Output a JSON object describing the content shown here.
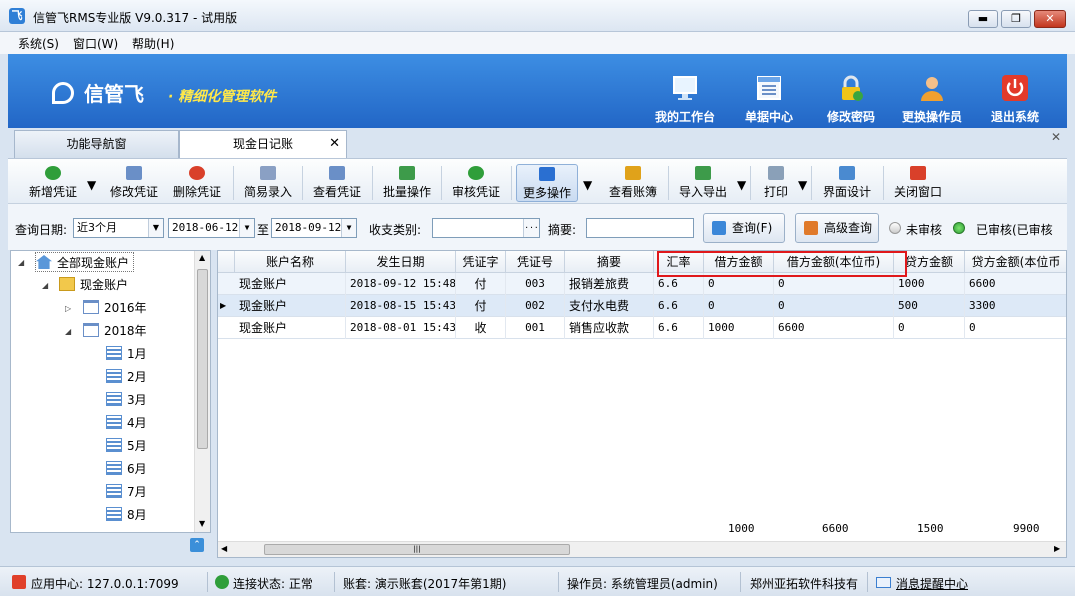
{
  "window": {
    "title": "信管飞RMS专业版 V9.0.317 - 试用版",
    "logo_glyph": "飞",
    "controls": {
      "minimize": "▬",
      "maximize": "❐",
      "close": "✕"
    }
  },
  "menubar": {
    "items": [
      "系统(S)",
      "窗口(W)",
      "帮助(H)"
    ]
  },
  "banner": {
    "brand_name": "信管飞",
    "slogan": "· 精细化管理软件",
    "buttons": [
      {
        "label": "我的工作台",
        "icon": "monitor-icon"
      },
      {
        "label": "单据中心",
        "icon": "document-list-icon"
      },
      {
        "label": "修改密码",
        "icon": "lock-icon"
      },
      {
        "label": "更换操作员",
        "icon": "user-icon"
      },
      {
        "label": "退出系统",
        "icon": "power-icon"
      }
    ]
  },
  "tabs": [
    {
      "label": "功能导航窗",
      "active": false
    },
    {
      "label": "现金日记账",
      "active": true,
      "close": "✕"
    }
  ],
  "panel_close": "✕",
  "toolbar": {
    "buttons": [
      {
        "label": "新增凭证",
        "icon": "add-icon",
        "dropdown": true,
        "color": "#2f9e3a"
      },
      {
        "label": "修改凭证",
        "icon": "edit-icon",
        "color": "#6a8fc7"
      },
      {
        "label": "删除凭证",
        "icon": "delete-icon",
        "color": "#d9402a"
      },
      {
        "label": "简易录入",
        "icon": "grid-icon",
        "color": "#8aa0c4"
      },
      {
        "label": "查看凭证",
        "icon": "view-icon",
        "color": "#6a8fc7"
      },
      {
        "label": "批量操作",
        "icon": "batch-icon",
        "color": "#3d9b4a"
      },
      {
        "label": "审核凭证",
        "icon": "approve-icon",
        "color": "#2f9e3a"
      },
      {
        "label": "更多操作",
        "icon": "double-chevron-down-icon",
        "dropdown": true,
        "color": "#2a6fd1"
      },
      {
        "label": "查看账簿",
        "icon": "ledger-icon",
        "color": "#e0a21a"
      },
      {
        "label": "导入导出",
        "icon": "import-export-icon",
        "dropdown": true,
        "color": "#3d9b4a"
      },
      {
        "label": "打印",
        "icon": "printer-icon",
        "dropdown": true,
        "color": "#8aa0b8"
      },
      {
        "label": "界面设计",
        "icon": "design-icon",
        "color": "#4a8ad0"
      },
      {
        "label": "关闭窗口",
        "icon": "close-window-icon",
        "color": "#d9402a"
      }
    ],
    "dropdown_glyph": "▼"
  },
  "query": {
    "date_label": "查询日期:",
    "period": "近3个月",
    "start_date": "2018-06-12",
    "to_label": "至",
    "end_date": "2018-09-12",
    "type_label": "收支类别:",
    "type_value": "",
    "type_button": "···",
    "summary_label": "摘要:",
    "summary_value": "",
    "query_button": "查询(F)",
    "advanced_button": "高级查询",
    "unapproved_label": "未审核",
    "approved_label": "已审核(已审核",
    "arrow": "▼"
  },
  "tree": {
    "nodes": [
      {
        "label": "全部现金账户",
        "icon": "home-icon",
        "toggle": "◢",
        "level": 0
      },
      {
        "label": "现金账户",
        "icon": "folder-icon",
        "toggle": "◢",
        "level": 1
      },
      {
        "label": "2016年",
        "icon": "calendar-icon",
        "toggle": "▷",
        "level": 2
      },
      {
        "label": "2018年",
        "icon": "calendar-icon",
        "toggle": "◢",
        "level": 2
      },
      {
        "label": "1月",
        "icon": "list-icon",
        "level": 3
      },
      {
        "label": "2月",
        "icon": "list-icon",
        "level": 3
      },
      {
        "label": "3月",
        "icon": "list-icon",
        "level": 3
      },
      {
        "label": "4月",
        "icon": "list-icon",
        "level": 3
      },
      {
        "label": "5月",
        "icon": "list-icon",
        "level": 3
      },
      {
        "label": "6月",
        "icon": "list-icon",
        "level": 3
      },
      {
        "label": "7月",
        "icon": "list-icon",
        "level": 3
      },
      {
        "label": "8月",
        "icon": "list-icon",
        "level": 3
      }
    ],
    "scroll_up": "▲",
    "scroll_down": "▼",
    "bottom_icon": "⌃"
  },
  "grid": {
    "columns": [
      "账户名称",
      "发生日期",
      "凭证字",
      "凭证号",
      "摘要",
      "汇率",
      "借方金额",
      "借方金额(本位币)",
      "贷方金额",
      "贷方金额(本位币"
    ],
    "rows": [
      [
        "现金账户",
        "2018-09-12 15:48",
        "付",
        "003",
        "报销差旅费",
        "6.6",
        "0",
        "0",
        "1000",
        "6600"
      ],
      [
        "现金账户",
        "2018-08-15 15:43",
        "付",
        "002",
        "支付水电费",
        "6.6",
        "0",
        "0",
        "500",
        "3300"
      ],
      [
        "现金账户",
        "2018-08-01 15:43",
        "收",
        "001",
        "销售应收款",
        "6.6",
        "1000",
        "6600",
        "0",
        "0"
      ]
    ],
    "current_row_marker": "▶",
    "totals": [
      "1000",
      "6600",
      "1500",
      "9900"
    ],
    "scroll_left": "◀",
    "scroll_right": "▶",
    "scroll_grip": "|||"
  },
  "statusbar": {
    "app_center": "应用中心: 127.0.0.1:7099",
    "connection": "连接状态: 正常",
    "account_set": "账套: 演示账套(2017年第1期)",
    "operator": "操作员: 系统管理员(admin)",
    "company": "郑州亚拓软件科技有",
    "message_center": "消息提醒中心"
  },
  "colors": {
    "banner": "#2f7ad8",
    "highlight_border": "#e0181b",
    "slogan": "#ffe84a"
  }
}
